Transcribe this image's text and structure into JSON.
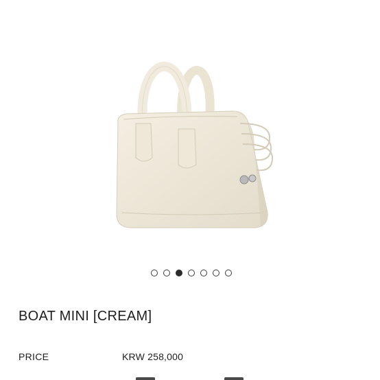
{
  "product": {
    "name": "BOAT MINI [CREAM]",
    "price_label": "PRICE",
    "price": "KRW 258,000",
    "color": "#efe9da"
  },
  "carousel": {
    "total": 7,
    "active_index": 2
  }
}
